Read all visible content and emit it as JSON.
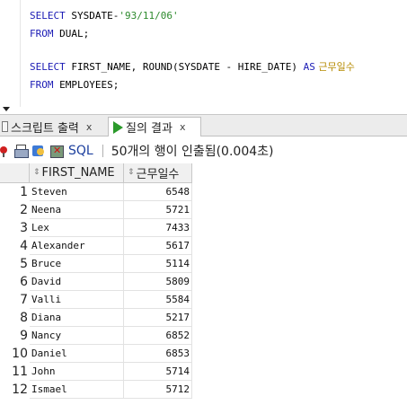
{
  "editor": {
    "line1": {
      "kw": "SELECT",
      "plain": " SYSDATE-",
      "str": "'93/11/06'"
    },
    "line2": {
      "kw": "FROM",
      "plain": " DUAL;"
    },
    "line3": {
      "kw1": "SELECT",
      "plain1": " FIRST_NAME, ROUND(SYSDATE - HIRE_DATE) ",
      "kw2": "AS",
      "alias": " 근무일수"
    },
    "line4": {
      "kw": "FROM",
      "plain": " EMPLOYEES;"
    }
  },
  "tabs": [
    {
      "label": "스크립트 출력",
      "close": "x",
      "icon": "document-icon"
    },
    {
      "label": "질의 결과",
      "close": "x",
      "icon": "play-icon"
    }
  ],
  "toolbar": {
    "icons": [
      "pin-icon",
      "print-icon",
      "refresh-icon",
      "export-excel-icon"
    ],
    "sql_label": "SQL",
    "separator": "|",
    "status": "50개의 행이 인출됨(0.004초)"
  },
  "grid": {
    "sort_glyph": "⇕",
    "columns": [
      "FIRST_NAME",
      "근무일수"
    ],
    "rows": [
      {
        "n": "1",
        "first_name": "Steven",
        "days": "6548"
      },
      {
        "n": "2",
        "first_name": "Neena",
        "days": "5721"
      },
      {
        "n": "3",
        "first_name": "Lex",
        "days": "7433"
      },
      {
        "n": "4",
        "first_name": "Alexander",
        "days": "5617"
      },
      {
        "n": "5",
        "first_name": "Bruce",
        "days": "5114"
      },
      {
        "n": "6",
        "first_name": "David",
        "days": "5809"
      },
      {
        "n": "7",
        "first_name": "Valli",
        "days": "5584"
      },
      {
        "n": "8",
        "first_name": "Diana",
        "days": "5217"
      },
      {
        "n": "9",
        "first_name": "Nancy",
        "days": "6852"
      },
      {
        "n": "10",
        "first_name": "Daniel",
        "days": "6853"
      },
      {
        "n": "11",
        "first_name": "John",
        "days": "5714"
      },
      {
        "n": "12",
        "first_name": "Ismael",
        "days": "5712"
      }
    ]
  },
  "colors": {
    "keyword": "#1b1bb5",
    "string": "#2d8a2d",
    "alias": "#b58a00",
    "run_icon": "#2b9a2b",
    "sql_label": "#1c3f9e"
  }
}
